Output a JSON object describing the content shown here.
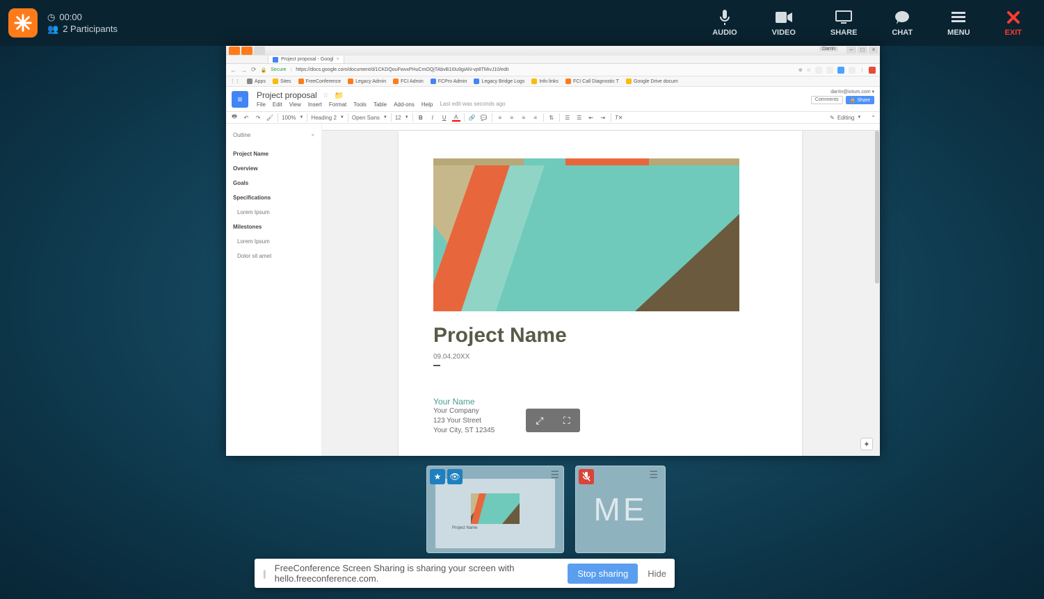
{
  "topbar": {
    "timer": "00:00",
    "participants": "2 Participants",
    "buttons": {
      "audio": "AUDIO",
      "video": "VIDEO",
      "share": "SHARE",
      "chat": "CHAT",
      "menu": "MENU",
      "exit": "EXIT"
    }
  },
  "browser": {
    "tabTitle": "Project proposal - Googl",
    "secure": "Secure",
    "url": "https://docs.google.com/document/d/1CKDQouFwvxPHuCmOQjTAbvB1I0u9giAN-vp8TMivJ10/edit",
    "userLabel": "Darrin",
    "bookmarks": [
      "Apps",
      "Sites",
      "FreeConference",
      "Legacy Admin",
      "FCI Admin",
      "FCPro Admin",
      "Legacy Bridge Logs",
      "Info links",
      "FCI Call Diagnostic T",
      "Google Drive docum"
    ]
  },
  "docs": {
    "title": "Project proposal",
    "menu": [
      "File",
      "Edit",
      "View",
      "Insert",
      "Format",
      "Tools",
      "Table",
      "Add-ons",
      "Help"
    ],
    "lastEdit": "Last edit was seconds ago",
    "email": "darrin@iotum.com ▾",
    "comments": "Comments",
    "share": "Share",
    "toolbar": {
      "zoom": "100%",
      "style": "Heading 2",
      "font": "Open Sans",
      "size": "12",
      "editing": "Editing"
    },
    "outlineTitle": "Outline",
    "outline": [
      {
        "label": "Project Name",
        "sub": false
      },
      {
        "label": "Overview",
        "sub": false
      },
      {
        "label": "Goals",
        "sub": false
      },
      {
        "label": "Specifications",
        "sub": false
      },
      {
        "label": "Lorem Ipsum",
        "sub": true
      },
      {
        "label": "Milestones",
        "sub": false
      },
      {
        "label": "Lorem Ipsum",
        "sub": true
      },
      {
        "label": "Dolor sit amet",
        "sub": true
      }
    ],
    "page": {
      "title": "Project Name",
      "date": "09.04.20XX",
      "yourName": "Your Name",
      "company": "Your Company",
      "street": "123 Your Street",
      "city": "Your City, ST 12345"
    }
  },
  "thumbs": {
    "previewCaption": "Project Name",
    "me": "ME"
  },
  "shareBar": {
    "message": "FreeConference Screen Sharing is sharing your screen with hello.freeconference.com.",
    "stop": "Stop sharing",
    "hide": "Hide"
  }
}
